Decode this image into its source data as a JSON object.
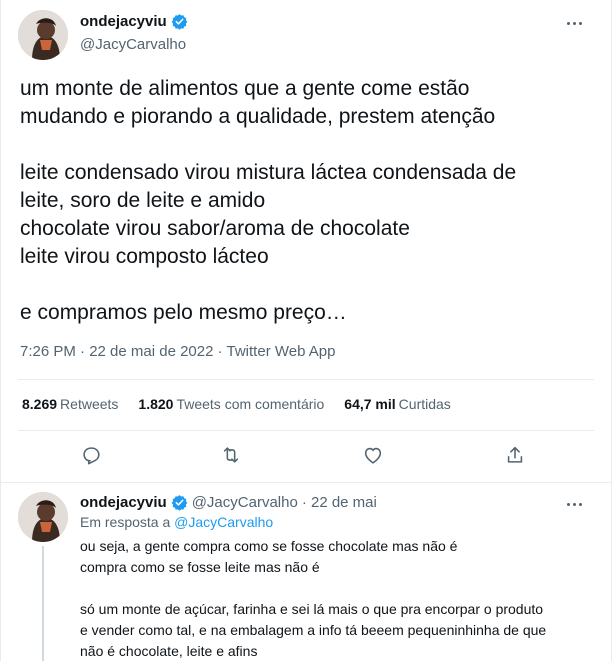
{
  "main_tweet": {
    "display_name": "ondejacyviu",
    "handle": "@JacyCarvalho",
    "text": "um monte de alimentos que a gente come estão\nmudando e piorando a qualidade, prestem atenção\n\nleite condensado virou mistura láctea condensada de\nleite, soro de leite e amido\nchocolate virou sabor/aroma de chocolate\nleite virou composto lácteo\n\ne compramos pelo mesmo preço…",
    "timestamp": "7:26 PM · 22 de mai de 2022 · Twitter Web App",
    "stats": {
      "retweets_count": "8.269",
      "retweets_label": "Retweets",
      "quotes_count": "1.820",
      "quotes_label": "Tweets com comentário",
      "likes_count": "64,7 mil",
      "likes_label": "Curtidas"
    }
  },
  "reply_tweet": {
    "display_name": "ondejacyviu",
    "handle": "@JacyCarvalho",
    "date": "· 22 de mai",
    "reply_prefix": "Em resposta a",
    "reply_handle": "@JacyCarvalho",
    "text": "ou seja, a gente compra como se fosse chocolate mas não é\ncompra como se fosse leite mas não é\n\nsó um monte de açúcar, farinha e sei lá mais o que pra encorpar o produto\ne vender como tal, e na embalagem a info tá beeem pequeninhinha de que\nnão é chocolate, leite e afins"
  },
  "icons": {
    "verified": "verified-badge-icon",
    "more": "more-icon",
    "reply": "reply-icon",
    "retweet": "retweet-icon",
    "like": "like-icon",
    "share": "share-icon"
  },
  "colors": {
    "accent": "#1d9bf0",
    "secondary_text": "#536471",
    "primary_text": "#0f1419",
    "divider": "#e8ecef"
  }
}
